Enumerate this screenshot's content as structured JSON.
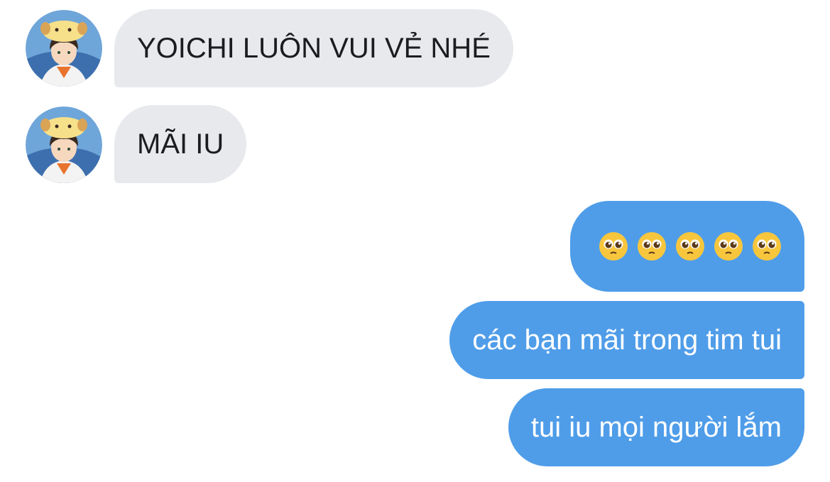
{
  "conversation": {
    "incoming_messages": [
      {
        "text": "YOICHI LUÔN VUI VẺ NHÉ"
      },
      {
        "text": "MÃI IU"
      }
    ],
    "outgoing_messages": [
      {
        "emoji": [
          "pleading-face",
          "pleading-face",
          "pleading-face",
          "pleading-face",
          "pleading-face"
        ]
      },
      {
        "text": "các bạn mãi trong tim tui"
      },
      {
        "text": "tui iu mọi người lắm"
      }
    ]
  },
  "colors": {
    "incoming_bubble": "#e7e9ed",
    "outgoing_bubble": "#4f9de9",
    "incoming_text": "#1c1c1e",
    "outgoing_text": "#ffffff"
  }
}
